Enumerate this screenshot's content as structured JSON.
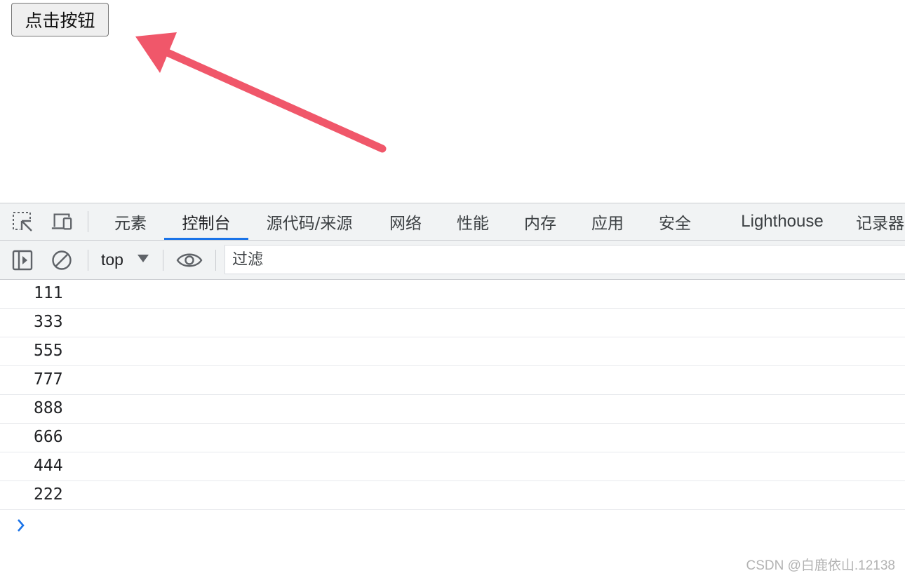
{
  "page": {
    "button_label": "点击按钮"
  },
  "annotation": {
    "arrow_color": "#f0576a"
  },
  "devtools": {
    "tabs": [
      {
        "label": "元素",
        "active": false
      },
      {
        "label": "控制台",
        "active": true
      },
      {
        "label": "源代码/来源",
        "active": false
      },
      {
        "label": "网络",
        "active": false
      },
      {
        "label": "性能",
        "active": false
      },
      {
        "label": "内存",
        "active": false
      },
      {
        "label": "应用",
        "active": false
      },
      {
        "label": "安全",
        "active": false
      },
      {
        "label": "Lighthouse",
        "active": false
      },
      {
        "label": "记录器",
        "active": false
      }
    ],
    "toolbar": {
      "context": "top",
      "filter_placeholder": "过滤"
    },
    "console_logs": [
      "111",
      "333",
      "555",
      "777",
      "888",
      "666",
      "444",
      "222"
    ],
    "accent_color": "#1a73e8"
  },
  "watermark": "CSDN @白鹿依山.12138"
}
